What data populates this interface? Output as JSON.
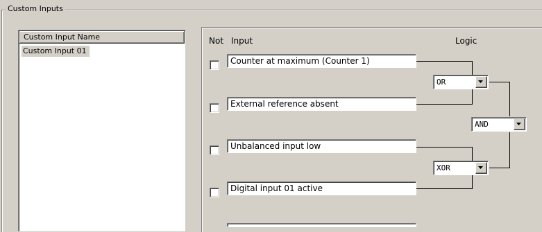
{
  "group": {
    "title": "Custom Inputs"
  },
  "list": {
    "header": "Custom Input Name",
    "items": [
      "Custom Input 01"
    ]
  },
  "panel": {
    "not_header": "Not",
    "input_header": "Input",
    "logic_header": "Logic",
    "inputs": [
      {
        "text": "Counter at maximum (Counter 1)",
        "checked": false
      },
      {
        "text": "External reference absent",
        "checked": false
      },
      {
        "text": "Unbalanced input low",
        "checked": false
      },
      {
        "text": "Digital input 01 active",
        "checked": false
      }
    ],
    "logic": {
      "combo1": "OR",
      "combo2": "AND",
      "combo3": "XOR"
    }
  }
}
